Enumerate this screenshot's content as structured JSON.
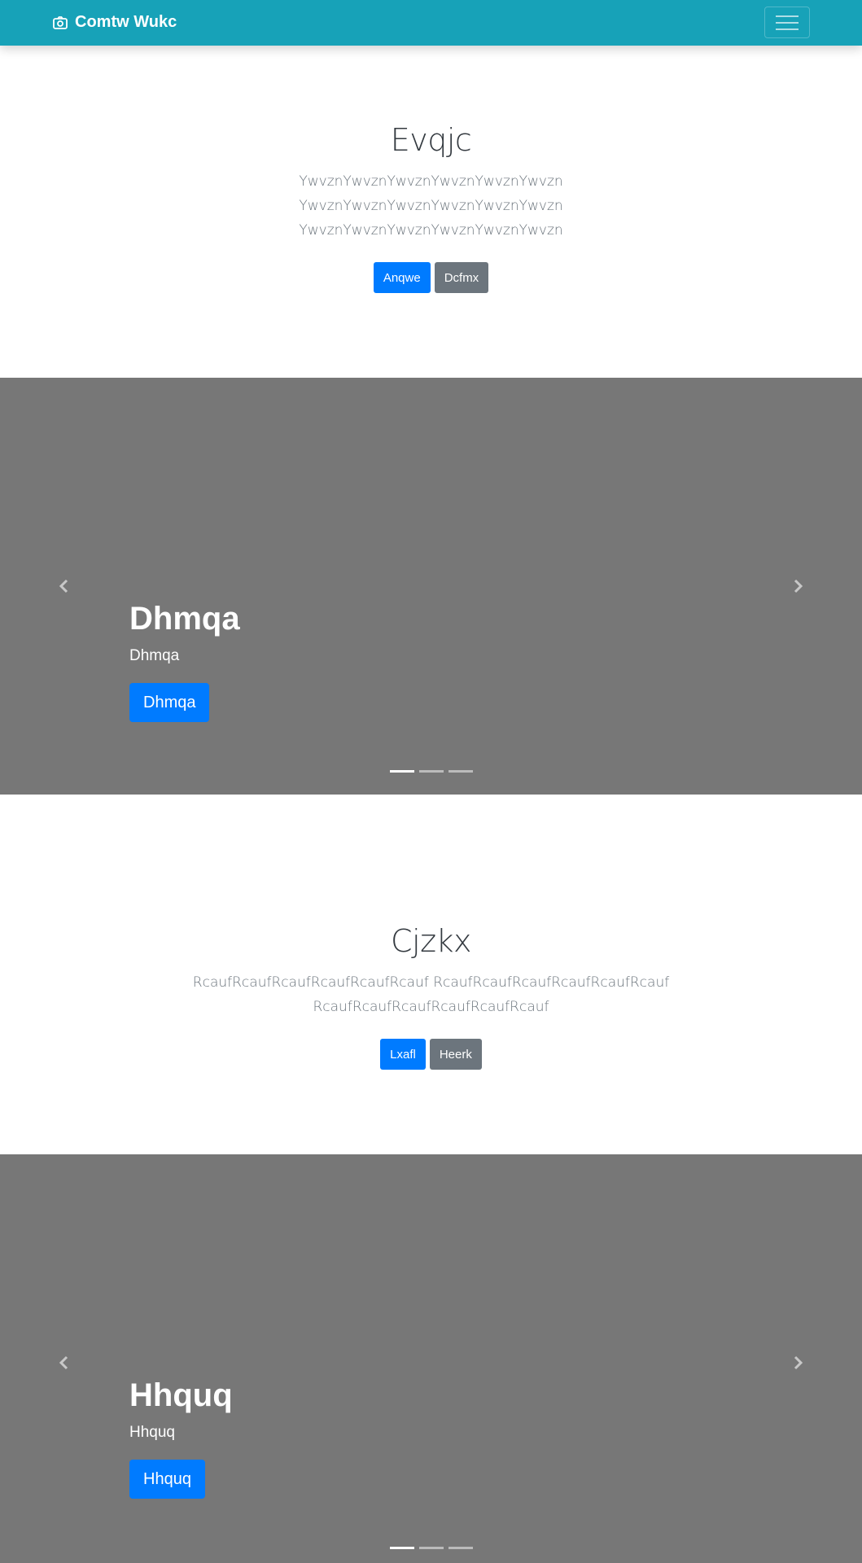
{
  "navbar": {
    "brand": "Comtw Wukc",
    "brand_icon": "camera-icon",
    "toggler_icon": "hamburger-icon",
    "background": "#17a2b8"
  },
  "hero1": {
    "title": "Evqjc",
    "lines": [
      "YwvznYwvznYwvznYwvznYwvznYwvzn",
      "YwvznYwvznYwvznYwvznYwvznYwvzn",
      "YwvznYwvznYwvznYwvznYwvznYwvzn"
    ],
    "primary_button": "Anqwe",
    "secondary_button": "Dcfmx"
  },
  "carousel1": {
    "heading": "Dhmqa",
    "subtext": "Dhmqa",
    "button": "Dhmqa",
    "prev_icon": "chevron-left-icon",
    "next_icon": "chevron-right-icon",
    "indicator_count": 3,
    "active_indicator": 1
  },
  "hero2": {
    "title": "Cjzkx",
    "lines": [
      "RcaufRcaufRcaufRcaufRcaufRcauf RcaufRcaufRcaufRcaufRcaufRcauf",
      "RcaufRcaufRcaufRcaufRcaufRcauf"
    ],
    "primary_button": "Lxafl",
    "secondary_button": "Heerk"
  },
  "carousel2": {
    "heading": "Hhquq",
    "subtext": "Hhquq",
    "button": "Hhquq",
    "prev_icon": "chevron-left-icon",
    "next_icon": "chevron-right-icon",
    "indicator_count": 3,
    "active_indicator": 1
  },
  "colors": {
    "primary": "#007bff",
    "secondary": "#6c757d",
    "carousel_bg": "#777777"
  }
}
